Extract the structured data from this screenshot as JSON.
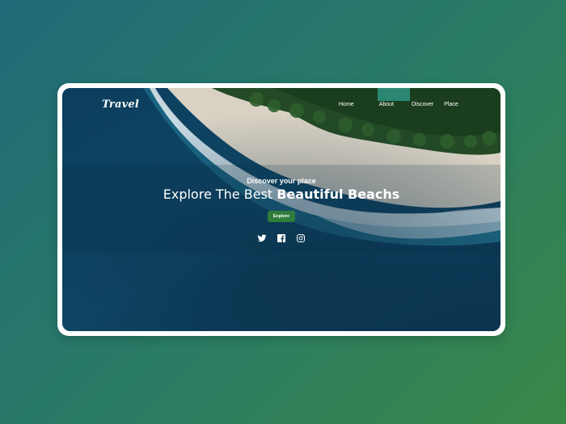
{
  "brand": {
    "logo": "Travel"
  },
  "nav": {
    "items": [
      {
        "label": "Home"
      },
      {
        "label": "About"
      },
      {
        "label": "Discover"
      },
      {
        "label": "Place"
      }
    ]
  },
  "hero": {
    "subtitle": "Discover your place",
    "headline_regular": "Explore The Best ",
    "headline_bold": "Beautiful Beachs",
    "cta_label": "Explore"
  },
  "socials": {
    "icons": [
      "twitter-icon",
      "facebook-icon",
      "instagram-icon"
    ]
  },
  "colors": {
    "background_start": "#1f6a78",
    "background_end": "#3a8747",
    "button": "#2f7d3a",
    "sea": "#0d3a58",
    "sand": "#d9d2c4"
  }
}
